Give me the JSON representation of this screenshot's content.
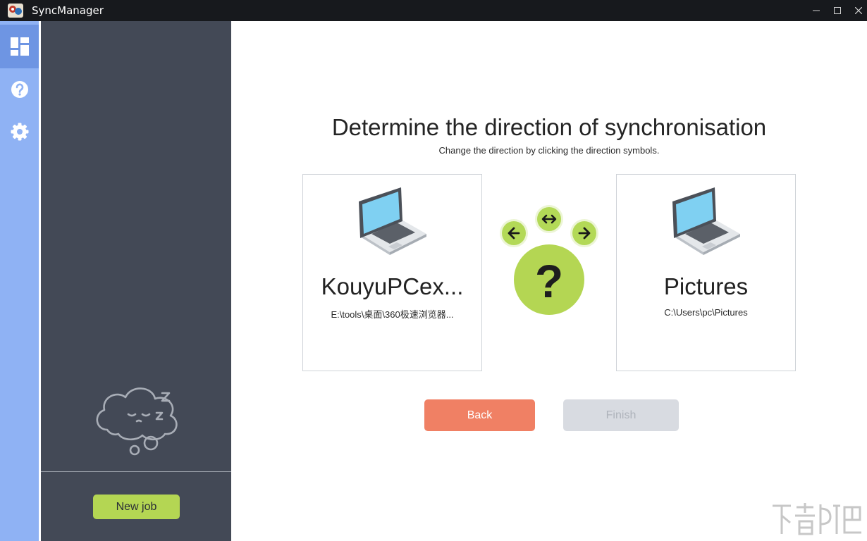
{
  "window": {
    "title": "SyncManager",
    "controls": {
      "minimize": "–",
      "maximize": "□",
      "close": "✕"
    }
  },
  "rail": {
    "items": [
      {
        "icon": "dashboard-icon",
        "active": true
      },
      {
        "icon": "help-icon",
        "active": false
      },
      {
        "icon": "gear-icon",
        "active": false
      }
    ]
  },
  "sidebar": {
    "illustration": "sleeping-cloud",
    "new_job_label": "New job"
  },
  "main": {
    "title": "Determine the direction of synchronisation",
    "subtitle": "Change the direction by clicking the direction symbols.",
    "source": {
      "name": "KouyuPCex...",
      "path": "E:\\tools\\桌面\\360极速浏览器..."
    },
    "target": {
      "name": "Pictures",
      "path": "C:\\Users\\pc\\Pictures"
    },
    "direction": {
      "current": "?",
      "options": [
        "left-arrow",
        "both-arrow",
        "right-arrow"
      ]
    },
    "back_label": "Back",
    "finish_label": "Finish"
  },
  "colors": {
    "titlebar": "#17191d",
    "rail": "#8fb2f4",
    "sidebar": "#434956",
    "accent_green": "#b4d653",
    "back_orange": "#f08064",
    "disabled": "#d8dbe1"
  }
}
